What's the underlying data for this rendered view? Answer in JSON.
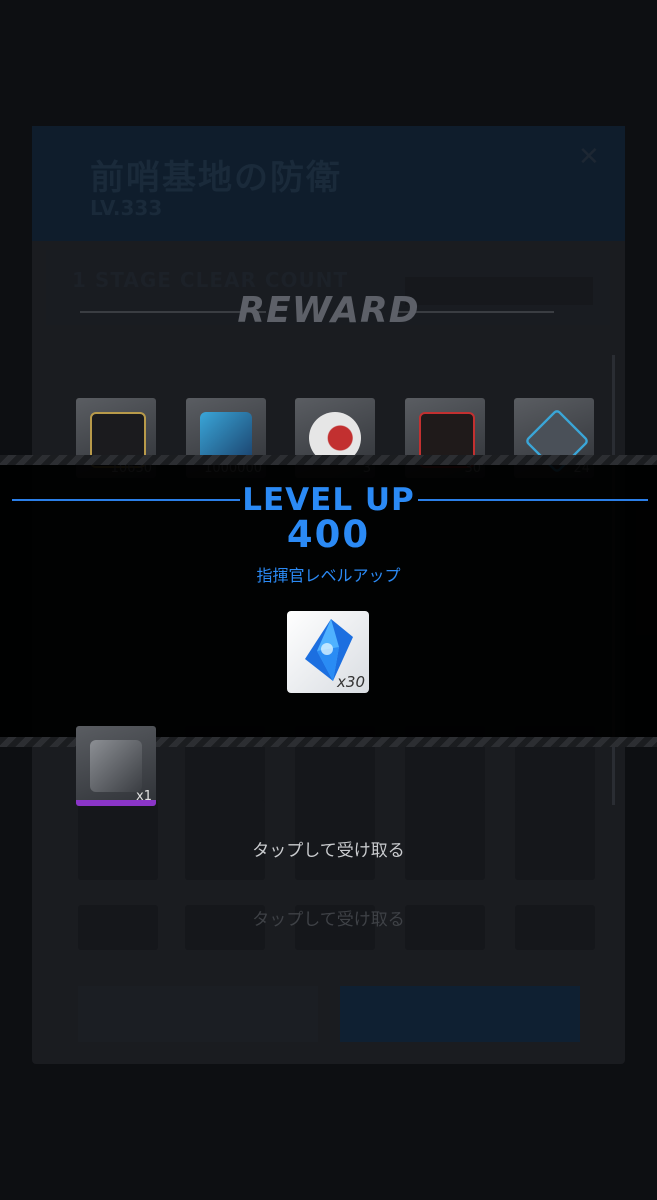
{
  "background": {
    "stage_title": "前哨基地の防衛",
    "stage_level": "LV.333",
    "close_icon": "close-icon",
    "clear_count_label": "1 STAGE CLEAR COUNT"
  },
  "reward": {
    "title": "REWARD",
    "items": [
      {
        "icon": "credit-card-icon",
        "count": "10630",
        "rarity_color": "#b89a4a"
      },
      {
        "icon": "battery-icon",
        "count": "1000000",
        "rarity_color": "#3aa6d8"
      },
      {
        "icon": "orb-icon",
        "count": "3",
        "rarity_color": "#c23030"
      },
      {
        "icon": "datapad-icon",
        "count": "30",
        "rarity_color": "#c23030"
      },
      {
        "icon": "core-chip-icon",
        "count": "24",
        "rarity_color": "#3aa6d8"
      }
    ],
    "gear_item": {
      "icon": "arm-gear-icon",
      "count": "x1",
      "rarity_color": "#8a35c7"
    }
  },
  "level_up": {
    "title": "LEVEL UP",
    "level": "400",
    "subtitle": "指揮官レベルアップ",
    "reward_item": {
      "icon": "blue-gem-icon",
      "count": "x30"
    }
  },
  "prompts": {
    "tap_to_receive": "タップして受け取る",
    "tap_to_receive_bg": "タップして受け取る"
  }
}
